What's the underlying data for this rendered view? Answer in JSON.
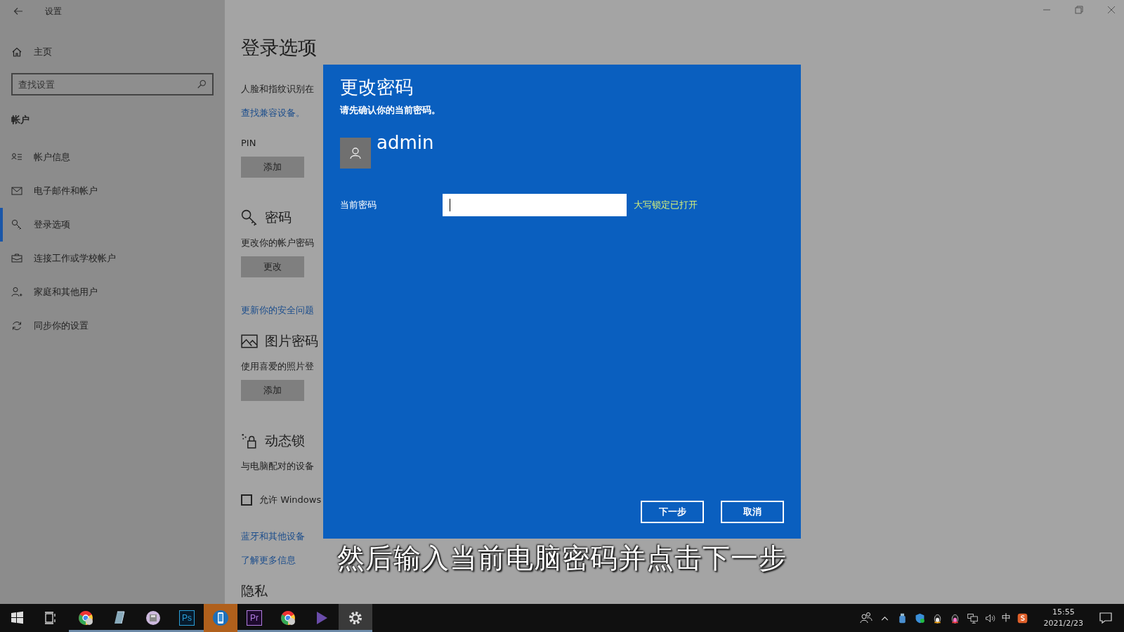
{
  "window": {
    "title": "设置"
  },
  "sidebar": {
    "home": "主页",
    "search": {
      "placeholder": "查找设置"
    },
    "section": "帐户",
    "items": [
      {
        "label": "帐户信息",
        "selected": false
      },
      {
        "label": "电子邮件和帐户",
        "selected": false
      },
      {
        "label": "登录选项",
        "selected": true
      },
      {
        "label": "连接工作或学校帐户",
        "selected": false
      },
      {
        "label": "家庭和其他用户",
        "selected": false
      },
      {
        "label": "同步你的设置",
        "selected": false
      }
    ]
  },
  "main": {
    "title": "登录选项",
    "blocks": [
      {
        "kind": "text",
        "text": "人脸和指纹识别在"
      },
      {
        "kind": "link",
        "text": "查找兼容设备。"
      },
      {
        "kind": "label",
        "text": "PIN"
      },
      {
        "kind": "button",
        "text": "添加"
      },
      {
        "kind": "heading",
        "text": "密码"
      },
      {
        "kind": "text",
        "text": "更改你的帐户密码"
      },
      {
        "kind": "button",
        "text": "更改"
      },
      {
        "kind": "link",
        "text": "更新你的安全问题"
      },
      {
        "kind": "heading",
        "text": "图片密码"
      },
      {
        "kind": "text",
        "text": "使用喜爱的照片登"
      },
      {
        "kind": "button",
        "text": "添加"
      },
      {
        "kind": "heading",
        "text": "动态锁"
      },
      {
        "kind": "text",
        "text": "与电脑配对的设备"
      },
      {
        "kind": "checkbox",
        "text": "允许 Windows",
        "checked": false
      },
      {
        "kind": "link",
        "text": "蓝牙和其他设备"
      },
      {
        "kind": "link",
        "text": "了解更多信息"
      },
      {
        "kind": "heading",
        "text": "隐私"
      }
    ]
  },
  "dialog": {
    "title": "更改密码",
    "subtitle": "请先确认你的当前密码。",
    "user": "admin",
    "field": {
      "label": "当前密码"
    },
    "caps_warning": "大写锁定已打开",
    "buttons": [
      "下一步",
      "取消"
    ]
  },
  "caption": "然后输入当前电脑密码并点击下一步",
  "taskbar": {
    "apps": [
      {
        "selected": false,
        "active": false,
        "open": true
      },
      {
        "selected": false,
        "active": false,
        "open": true
      },
      {
        "selected": false,
        "active": false,
        "open": true
      },
      {
        "label": "Ps",
        "selected": false,
        "active": false,
        "open": true
      },
      {
        "selected": true,
        "active": false,
        "open": false
      },
      {
        "label": "Pr",
        "selected": false,
        "active": false,
        "open": true
      },
      {
        "selected": false,
        "active": false,
        "open": true
      },
      {
        "selected": false,
        "active": false,
        "open": true
      },
      {
        "selected": false,
        "active": true,
        "open": true
      }
    ],
    "ime": "中",
    "time": "15:55",
    "date": "2021/2/23"
  }
}
